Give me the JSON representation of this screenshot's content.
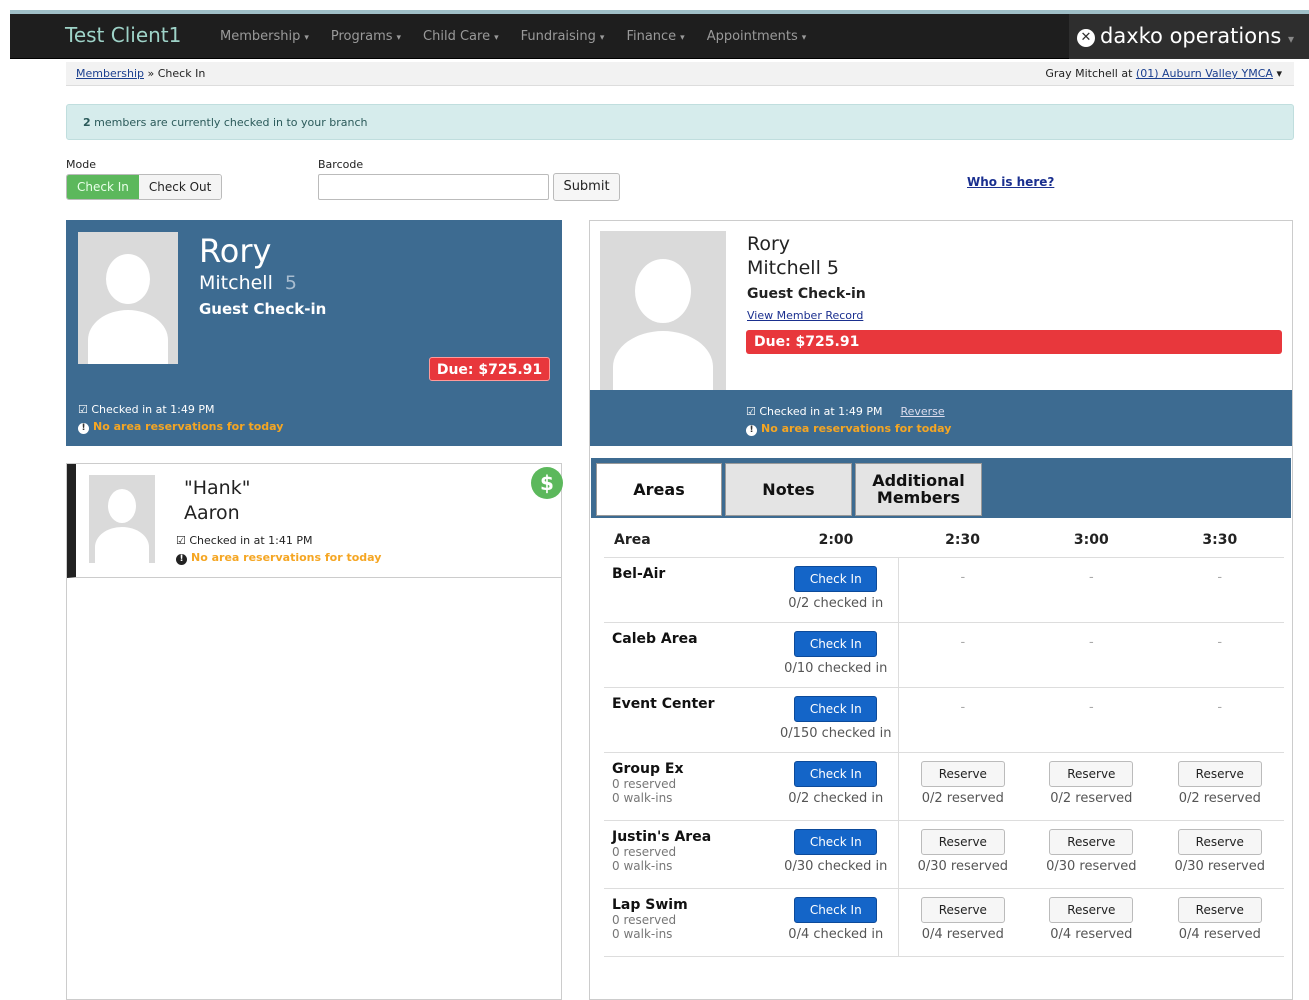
{
  "nav": {
    "client": "Test Client1",
    "menu": [
      "Membership",
      "Programs",
      "Child Care",
      "Fundraising",
      "Finance",
      "Appointments"
    ],
    "logo": "daxko operations",
    "logo_icon": "x-icon"
  },
  "breadcrumb": {
    "parent": "Membership",
    "separator": "»",
    "current": "Check In"
  },
  "user": {
    "prefix": "Gray Mitchell at",
    "branch": "(01) Auburn Valley YMCA"
  },
  "alert": {
    "count": "2",
    "text": "members are currently checked in to your branch"
  },
  "mode": {
    "label": "Mode",
    "options": [
      "Check In",
      "Check Out"
    ],
    "selected": "Check In"
  },
  "barcode": {
    "label": "Barcode",
    "value": "",
    "submit": "Submit"
  },
  "who_link": "Who is here?",
  "selected_member": {
    "first": "Rory",
    "last": "Mitchell",
    "number": "5",
    "full_last": "Mitchell 5",
    "type": "Guest Check-in",
    "due": "Due: $725.91",
    "checked_in": "Checked in at 1:49 PM",
    "no_reservations": "No area reservations for today",
    "view_record": "View Member Record",
    "reverse": "Reverse"
  },
  "other_member": {
    "first": "\"Hank\"",
    "last": "Aaron",
    "checked_in": "Checked in at 1:41 PM",
    "no_reservations": "No area reservations for today",
    "badge": "$"
  },
  "tabs": [
    "Areas",
    "Notes",
    "Additional",
    "Members"
  ],
  "areas": {
    "headers": [
      "Area",
      "2:00",
      "2:30",
      "3:00",
      "3:30"
    ],
    "rows": [
      {
        "name": "Bel-Air",
        "meta1": "",
        "meta2": "",
        "btn": "Check In",
        "status": "0/2 checked in",
        "slots": [
          "-",
          "-",
          "-"
        ]
      },
      {
        "name": "Caleb Area",
        "meta1": "",
        "meta2": "",
        "btn": "Check In",
        "status": "0/10 checked in",
        "slots": [
          "-",
          "-",
          "-"
        ]
      },
      {
        "name": "Event Center",
        "meta1": "",
        "meta2": "",
        "btn": "Check In",
        "status": "0/150 checked in",
        "slots": [
          "-",
          "-",
          "-"
        ]
      },
      {
        "name": "Group Ex",
        "meta1": "0 reserved",
        "meta2": "0 walk-ins",
        "btn": "Check In",
        "status": "0/2 checked in",
        "reserve": "Reserve",
        "slots": [
          "0/2 reserved",
          "0/2 reserved",
          "0/2 reserved"
        ]
      },
      {
        "name": "Justin's Area",
        "meta1": "0 reserved",
        "meta2": "0 walk-ins",
        "btn": "Check In",
        "status": "0/30 checked in",
        "reserve": "Reserve",
        "slots": [
          "0/30 reserved",
          "0/30 reserved",
          "0/30 reserved"
        ]
      },
      {
        "name": "Lap Swim",
        "meta1": "0 reserved",
        "meta2": "0 walk-ins",
        "btn": "Check In",
        "status": "0/4 checked in",
        "reserve": "Reserve",
        "slots": [
          "0/4 reserved",
          "0/4 reserved",
          "0/4 reserved"
        ]
      }
    ]
  },
  "colors": {
    "accent_blue": "#3d6b91",
    "due_red": "#e8373c",
    "success_green": "#5cb85c",
    "warning_orange": "#f5a623"
  }
}
